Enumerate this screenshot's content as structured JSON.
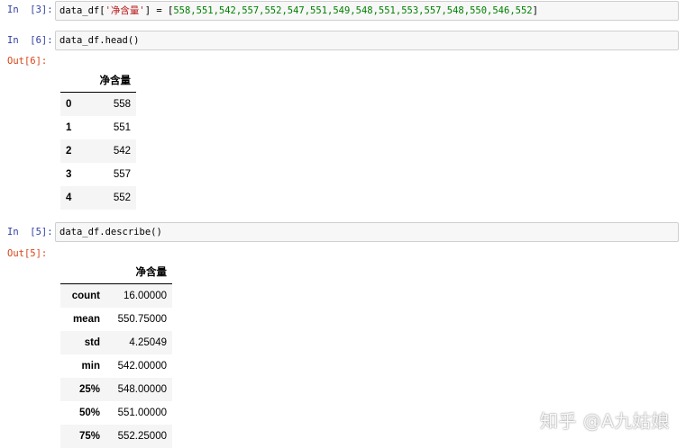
{
  "cells": [
    {
      "in_prompt": "In  [3]:",
      "code": {
        "var": "data_df[",
        "key": "'净含量'",
        "mid": "] = [",
        "list": "558,551,542,557,552,547,551,549,548,551,553,557,548,550,546,552",
        "end": "]"
      }
    },
    {
      "in_prompt": "In  [6]:",
      "code_text": "data_df.head()",
      "out_prompt": "Out[6]:",
      "table": {
        "column": "净含量",
        "rows": [
          {
            "index": "0",
            "value": "558"
          },
          {
            "index": "1",
            "value": "551"
          },
          {
            "index": "2",
            "value": "542"
          },
          {
            "index": "3",
            "value": "557"
          },
          {
            "index": "4",
            "value": "552"
          }
        ]
      }
    },
    {
      "in_prompt": "In  [5]:",
      "code_text": "data_df.describe()",
      "out_prompt": "Out[5]:",
      "table": {
        "column": "净含量",
        "rows": [
          {
            "index": "count",
            "value": "16.00000"
          },
          {
            "index": "mean",
            "value": "550.75000"
          },
          {
            "index": "std",
            "value": "4.25049"
          },
          {
            "index": "min",
            "value": "542.00000"
          },
          {
            "index": "25%",
            "value": "548.00000"
          },
          {
            "index": "50%",
            "value": "551.00000"
          },
          {
            "index": "75%",
            "value": "552.25000"
          }
        ]
      }
    }
  ],
  "watermark": "知乎 @A九姑娘"
}
